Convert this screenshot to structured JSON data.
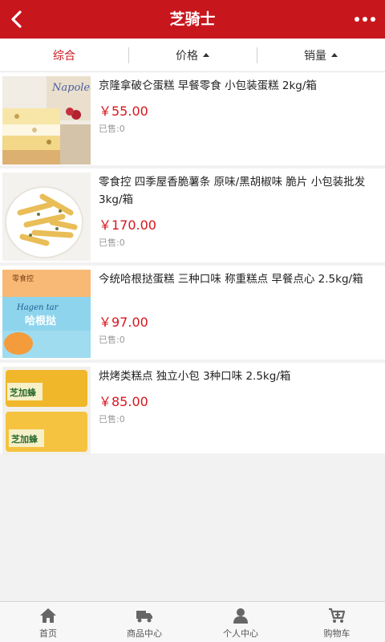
{
  "header": {
    "title": "芝骑士"
  },
  "sort": {
    "comprehensive": "综合",
    "price": "价格",
    "sales": "销量"
  },
  "products": [
    {
      "name": "京隆拿破仑蛋糕 早餐零食 小包装蛋糕 2kg/箱",
      "price": "￥55.00",
      "sold": "已售:0",
      "image_text": "Napoleon Cake"
    },
    {
      "name": "零食控 四季屋香脆薯条 原味/黑胡椒味 脆片 小包装批发 3kg/箱",
      "price": "￥170.00",
      "sold": "已售:0"
    },
    {
      "name": "今统哈根挞蛋糕 三种口味 称重糕点 早餐点心 2.5kg/箱",
      "price": "￥97.00",
      "sold": "已售:0",
      "image_text": {
        "brand": "零食控",
        "script": "Hagen tar",
        "cn": "哈根挞"
      }
    },
    {
      "name": "烘烤类糕点 独立小包 3种口味 2.5kg/箱",
      "price": "￥85.00",
      "sold": "已售:0",
      "image_text": "芝加蜂"
    }
  ],
  "tabbar": [
    {
      "label": "首页",
      "icon": "home-icon"
    },
    {
      "label": "商品中心",
      "icon": "truck-icon"
    },
    {
      "label": "个人中心",
      "icon": "user-icon"
    },
    {
      "label": "购物车",
      "icon": "cart-icon"
    }
  ],
  "colors": {
    "brand_red": "#c8161d",
    "price_red": "#d8161d"
  }
}
